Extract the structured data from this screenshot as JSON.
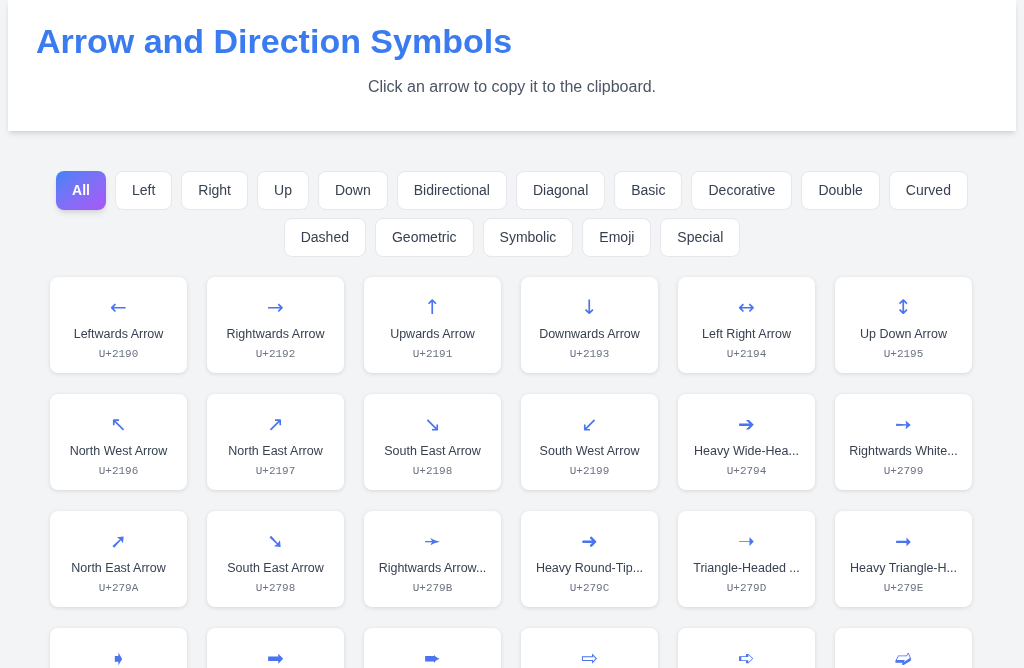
{
  "header": {
    "title": "Arrow and Direction Symbols",
    "subtitle": "Click an arrow to copy it to the clipboard."
  },
  "filters": [
    {
      "label": "All",
      "selected": true
    },
    {
      "label": "Left",
      "selected": false
    },
    {
      "label": "Right",
      "selected": false
    },
    {
      "label": "Up",
      "selected": false
    },
    {
      "label": "Down",
      "selected": false
    },
    {
      "label": "Bidirectional",
      "selected": false
    },
    {
      "label": "Diagonal",
      "selected": false
    },
    {
      "label": "Basic",
      "selected": false
    },
    {
      "label": "Decorative",
      "selected": false
    },
    {
      "label": "Double",
      "selected": false
    },
    {
      "label": "Curved",
      "selected": false
    },
    {
      "label": "Dashed",
      "selected": false
    },
    {
      "label": "Geometric",
      "selected": false
    },
    {
      "label": "Symbolic",
      "selected": false
    },
    {
      "label": "Emoji",
      "selected": false
    },
    {
      "label": "Special",
      "selected": false
    }
  ],
  "symbols": [
    {
      "symbol": "←",
      "name": "Leftwards Arrow",
      "code": "U+2190"
    },
    {
      "symbol": "→",
      "name": "Rightwards Arrow",
      "code": "U+2192"
    },
    {
      "symbol": "↑",
      "name": "Upwards Arrow",
      "code": "U+2191"
    },
    {
      "symbol": "↓",
      "name": "Downwards Arrow",
      "code": "U+2193"
    },
    {
      "symbol": "↔",
      "name": "Left Right Arrow",
      "code": "U+2194"
    },
    {
      "symbol": "↕",
      "name": "Up Down Arrow",
      "code": "U+2195"
    },
    {
      "symbol": "↖",
      "name": "North West Arrow",
      "code": "U+2196"
    },
    {
      "symbol": "↗",
      "name": "North East Arrow",
      "code": "U+2197"
    },
    {
      "symbol": "↘",
      "name": "South East Arrow",
      "code": "U+2198"
    },
    {
      "symbol": "↙",
      "name": "South West Arrow",
      "code": "U+2199"
    },
    {
      "symbol": "➔",
      "name": "Heavy Wide-Hea...",
      "code": "U+2794"
    },
    {
      "symbol": "➙",
      "name": "Rightwards White...",
      "code": "U+2799"
    },
    {
      "symbol": "➚",
      "name": "North East Arrow",
      "code": "U+279A"
    },
    {
      "symbol": "➘",
      "name": "South East Arrow",
      "code": "U+2798"
    },
    {
      "symbol": "➛",
      "name": "Rightwards Arrow...",
      "code": "U+279B"
    },
    {
      "symbol": "➜",
      "name": "Heavy Round-Tip...",
      "code": "U+279C"
    },
    {
      "symbol": "➝",
      "name": "Triangle-Headed ...",
      "code": "U+279D"
    },
    {
      "symbol": "➞",
      "name": "Heavy Triangle-H...",
      "code": "U+279E"
    },
    {
      "symbol": "➧"
    },
    {
      "symbol": "➡"
    },
    {
      "symbol": "➨"
    },
    {
      "symbol": "⇨"
    },
    {
      "symbol": "➪"
    },
    {
      "symbol": "➫"
    }
  ]
}
